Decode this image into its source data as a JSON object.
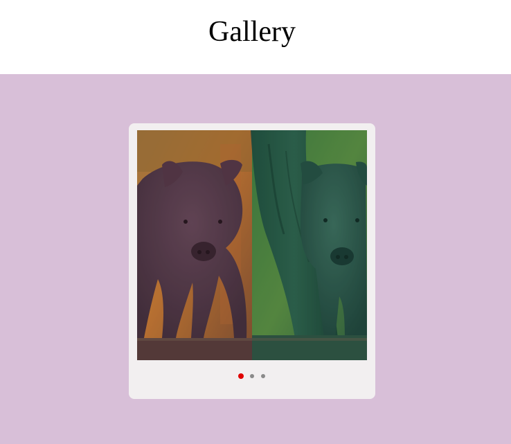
{
  "header": {
    "title": "Gallery"
  },
  "colors": {
    "stage_background": "#d8bfd8",
    "card_background": "#f2eff0",
    "dot_active": "#e00000",
    "dot_inactive": "#8a8a8a"
  },
  "carousel": {
    "slide_count": 3,
    "active_index": 0,
    "slide_names": [
      "wild-boar-photo",
      "slide-2",
      "slide-3"
    ]
  }
}
